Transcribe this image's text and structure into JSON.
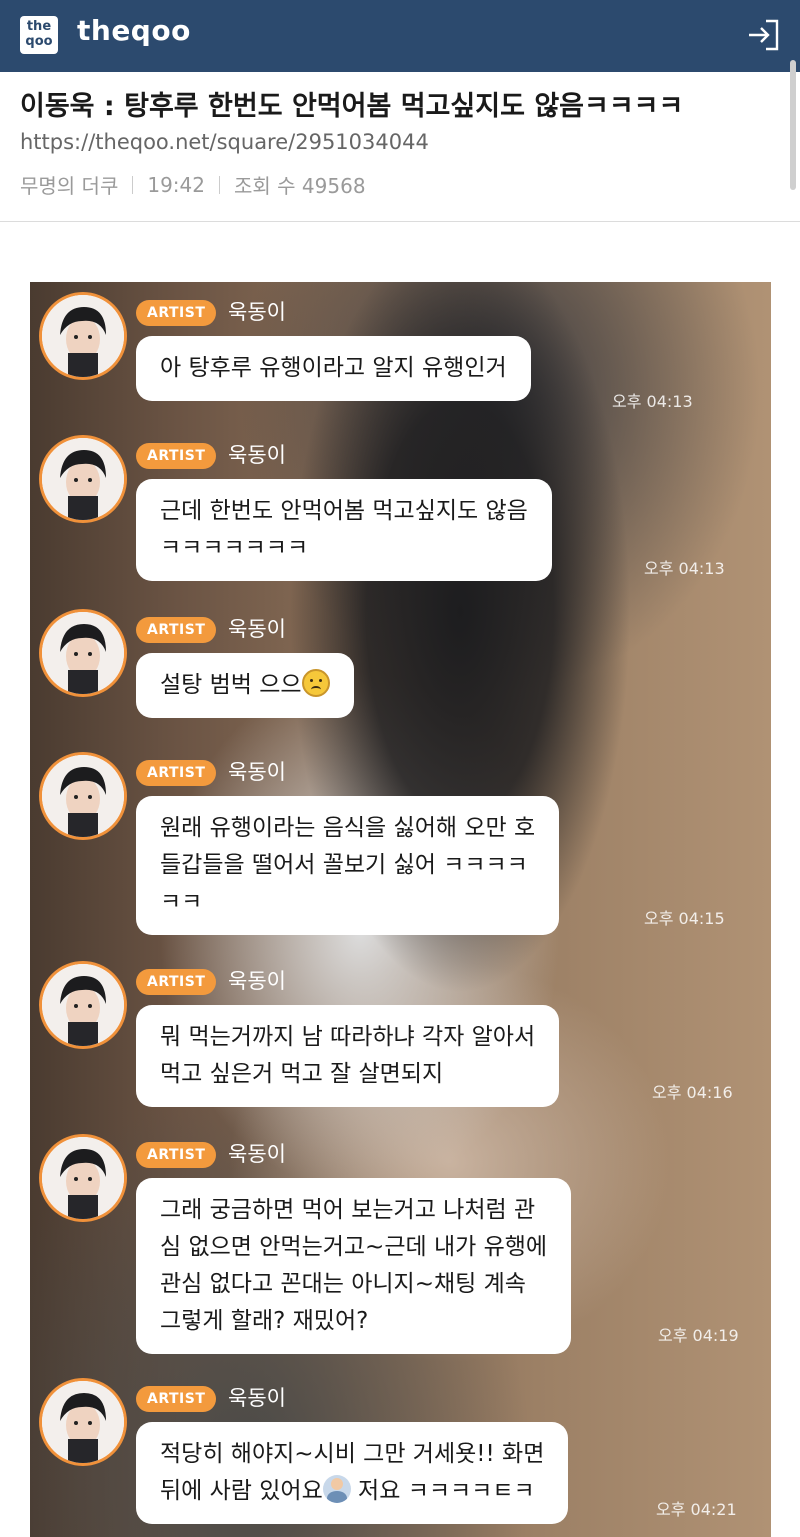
{
  "header": {
    "logo_top": "the",
    "logo_bottom": "qoo",
    "brand": "theqoo"
  },
  "post": {
    "title": "이동욱 : 탕후루 한번도 안먹어봄 먹고싶지도 않음ㅋㅋㅋㅋ",
    "url": "https://theqoo.net/square/2951034044",
    "author": "무명의 더쿠",
    "time": "19:42",
    "views": "조회 수 49568"
  },
  "chat": {
    "badge": "ARTIST",
    "name": "욱동이",
    "messages": [
      {
        "text": "아 탕후루 유행이라고 알지 유행인거",
        "time": "오후 04:13"
      },
      {
        "text": "근데 한번도 안먹어봄 먹고싶지도 않음\nㅋㅋㅋㅋㅋㅋㅋ",
        "time": "오후 04:13"
      },
      {
        "text": "설탕 범벅 으으",
        "emoji": "sad-face-emoji",
        "time": ""
      },
      {
        "text": "원래 유행이라는 음식을 싫어해 오만 호\n들갑들을 떨어서 꼴보기 싫어 ㅋㅋㅋㅋ\nㅋㅋ",
        "time": "오후 04:15"
      },
      {
        "text": "뭐 먹는거까지 남 따라하냐 각자 알아서\n먹고 싶은거 먹고 잘 살면되지",
        "time": "오후 04:16"
      },
      {
        "text": "그래 궁금하면 먹어 보는거고 나처럼 관\n심 없으면 안먹는거고~근데 내가 유행에\n관심 없다고 꼰대는 아니지~채팅 계속\n그렇게 할래? 재밌어?",
        "time": "오후 04:19"
      },
      {
        "text_a": "적당히 해야지~시비 그만 거세욧!! 화면\n뒤에 사람 있어요",
        "emoji": "person-raising-hand-emoji",
        "text_b": " 저요 ㅋㅋㅋㅋㅌㅋ",
        "time": "오후 04:21"
      }
    ]
  },
  "colors": {
    "header_bg": "#2c4a6e",
    "badge_bg": "#f39a3d",
    "avatar_ring": "#f0913a"
  }
}
